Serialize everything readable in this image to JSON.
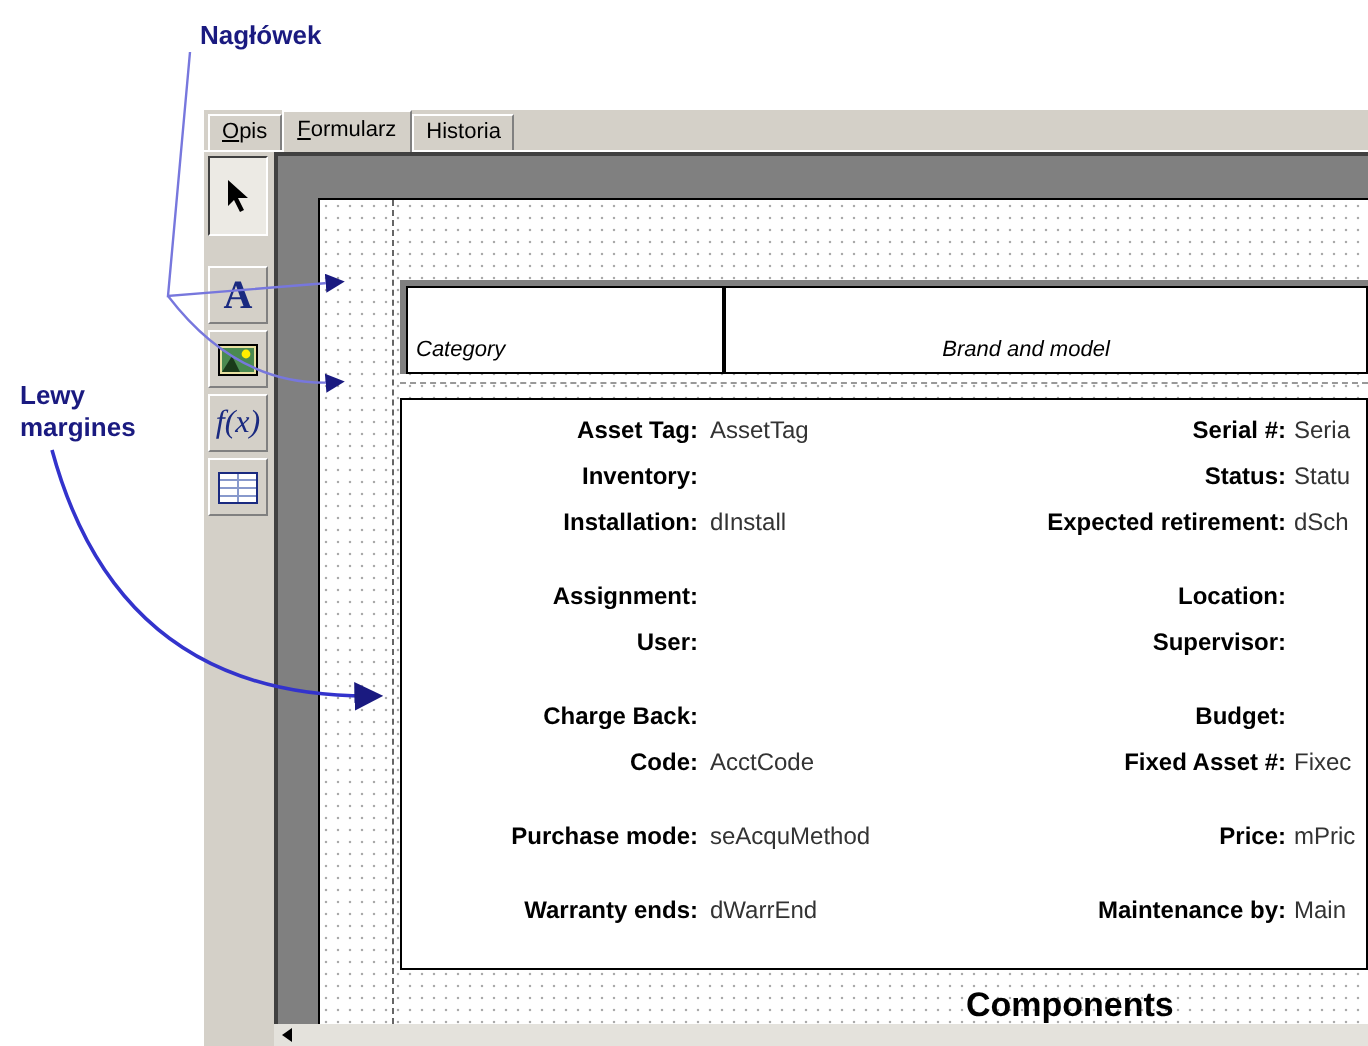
{
  "annotations": [
    {
      "kind": "header",
      "text": "Nagłówek"
    },
    {
      "kind": "margin",
      "text": "Lewy margines"
    }
  ],
  "tabs": [
    {
      "label": "Opis",
      "selected": false,
      "underline_first": true
    },
    {
      "label": "Formularz",
      "selected": true,
      "underline_first": true
    },
    {
      "label": "Historia",
      "selected": false,
      "underline_first": false
    }
  ],
  "tools": [
    {
      "kind": "pointer",
      "selected": true
    },
    {
      "kind": "text",
      "label": "A",
      "selected": false
    },
    {
      "kind": "image",
      "selected": false
    },
    {
      "kind": "formula",
      "label": "f(x)",
      "selected": false
    },
    {
      "kind": "table",
      "selected": false
    }
  ],
  "header_cells": [
    "Category",
    "Brand and model"
  ],
  "field_groups": [
    [
      {
        "label": "Asset Tag:",
        "value": "AssetTag",
        "right_label": "Serial #:",
        "right_value": "Seria"
      },
      {
        "label": "Inventory:",
        "right_label": "Status:",
        "right_value": "Statu"
      },
      {
        "label": "Installation:",
        "value": "dInstall",
        "right_label": "Expected retirement:",
        "right_value": "dSch"
      }
    ],
    [
      {
        "label": "Assignment:",
        "right_label": "Location:"
      },
      {
        "label": "User:",
        "right_label": "Supervisor:"
      }
    ],
    [
      {
        "label": "Charge Back:",
        "right_label": "Budget:"
      },
      {
        "label": "Code:",
        "value": "AcctCode",
        "right_label": "Fixed Asset #:",
        "right_value": "Fixec"
      }
    ],
    [
      {
        "label": "Purchase mode:",
        "value": "seAcquMethod",
        "right_label": "Price:",
        "right_value": "mPric"
      }
    ],
    [
      {
        "label": "Warranty ends:",
        "value": "dWarrEnd",
        "right_label": "Maintenance by:",
        "right_value": "Main"
      }
    ]
  ],
  "section_title": "Components"
}
